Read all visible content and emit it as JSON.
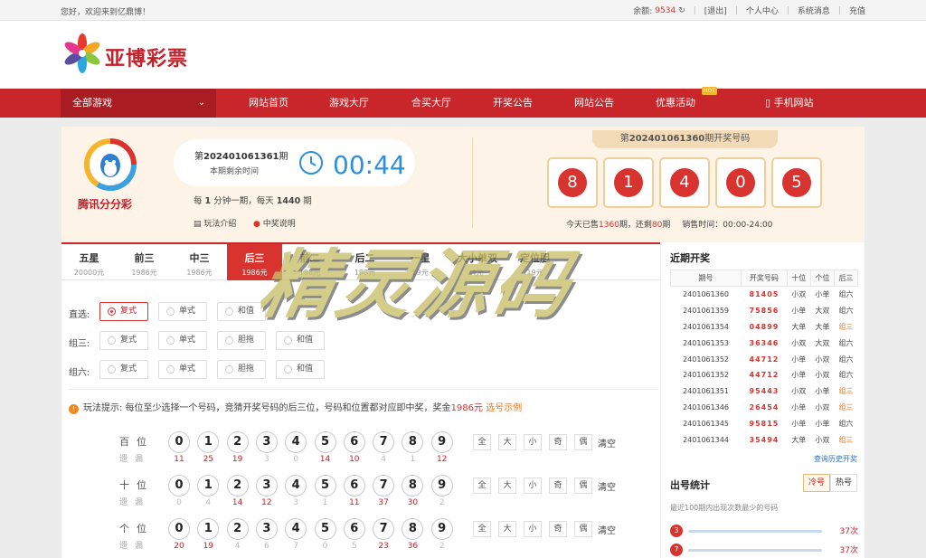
{
  "topbar": {
    "greeting": "您好，欢迎来到亿鼎博！",
    "balance_label": "余额:",
    "balance_value": "9534",
    "logout": "[退出]",
    "user_center": "个人中心",
    "messages": "系统消息",
    "recharge": "充值"
  },
  "brand": {
    "name": "亚博彩票"
  },
  "nav": {
    "all_games": "全部游戏",
    "items": [
      "网站首页",
      "游戏大厅",
      "合买大厅",
      "开奖公告",
      "网站公告",
      "优惠活动",
      "手机网站"
    ],
    "hot_badge": "HOT"
  },
  "game": {
    "name": "腾讯分分彩",
    "issue_prefix": "第",
    "issue_number": "202401061361",
    "issue_suffix": "期",
    "remaining_label": "本期剩余时间",
    "countdown": "00:44",
    "freq_a": "每",
    "freq_b": "1",
    "freq_c": "分钟一期，每天",
    "freq_d": "1440",
    "freq_e": "期",
    "rules_link": "玩法介绍",
    "prize_link": "中奖说明"
  },
  "last_draw": {
    "prefix": "第",
    "issue": "202401061360",
    "suffix": "期开奖号码",
    "balls": [
      "8",
      "1",
      "4",
      "0",
      "5"
    ],
    "sold_a": "今天已售",
    "sold_b": "1360",
    "sold_c": "期，还剩",
    "sold_d": "80",
    "sold_e": "期",
    "sale_time": "销售时间：00:00-24:00"
  },
  "tabs": [
    {
      "name": "五星",
      "prize": "20000元"
    },
    {
      "name": "前三",
      "prize": "1986元"
    },
    {
      "name": "中三",
      "prize": "1986元"
    },
    {
      "name": "后三",
      "prize": "1986元"
    },
    {
      "name": "前二",
      "prize": "198元"
    },
    {
      "name": "后二",
      "prize": "198元"
    },
    {
      "name": "一星",
      "prize": "19元"
    },
    {
      "name": "大小单双",
      "prize": "4元"
    },
    {
      "name": "定位胆",
      "prize": "19元"
    }
  ],
  "play_types": [
    {
      "label": "直选:",
      "options": [
        "复式",
        "单式",
        "和值"
      ]
    },
    {
      "label": "组三:",
      "options": [
        "复式",
        "单式",
        "胆拖",
        "和值"
      ]
    },
    {
      "label": "组六:",
      "options": [
        "复式",
        "单式",
        "胆拖",
        "和值"
      ]
    }
  ],
  "tip": {
    "label": "玩法提示:",
    "text": "每位至少选择一个号码，竞猜开奖号码的后三位，号码和位置都对应即中奖，奖金",
    "amount": "1986元",
    "link": "选号示例"
  },
  "number_rows": [
    {
      "position": "百位",
      "miss_label": "遗漏",
      "missing": [
        "11",
        "25",
        "19",
        "3",
        "0",
        "14",
        "10",
        "4",
        "1",
        "12"
      ]
    },
    {
      "position": "十位",
      "miss_label": "遗漏",
      "missing": [
        "0",
        "4",
        "14",
        "12",
        "3",
        "1",
        "11",
        "37",
        "30",
        "2"
      ]
    },
    {
      "position": "个位",
      "miss_label": "遗漏",
      "missing": [
        "20",
        "19",
        "4",
        "6",
        "7",
        "0",
        "5",
        "23",
        "36",
        "2"
      ]
    }
  ],
  "digits": [
    "0",
    "1",
    "2",
    "3",
    "4",
    "5",
    "6",
    "7",
    "8",
    "9"
  ],
  "quick_picks": [
    "全",
    "大",
    "小",
    "奇",
    "偶",
    "清空"
  ],
  "recent": {
    "title": "近期开奖",
    "headers": [
      "期号",
      "开奖号码",
      "十位",
      "个位",
      "后三"
    ],
    "rows": [
      [
        "2401061360",
        "81405",
        "小双",
        "小单",
        "组六"
      ],
      [
        "2401061359",
        "75856",
        "小单",
        "大双",
        "组六"
      ],
      [
        "2401061354",
        "04899",
        "大单",
        "大单",
        "组三"
      ],
      [
        "2401061353",
        "36346",
        "小双",
        "大双",
        "组六"
      ],
      [
        "2401061352",
        "44712",
        "小单",
        "小双",
        "组六"
      ],
      [
        "2401061352",
        "44712",
        "小单",
        "小双",
        "组六"
      ],
      [
        "2401061351",
        "95443",
        "小双",
        "小单",
        "组三"
      ],
      [
        "2401061346",
        "26454",
        "小单",
        "小双",
        "组三"
      ],
      [
        "2401061345",
        "95815",
        "小单",
        "小单",
        "组六"
      ],
      [
        "2401061344",
        "35494",
        "大单",
        "小双",
        "组三"
      ]
    ],
    "more": "查询历史开奖"
  },
  "stats": {
    "title": "出号统计",
    "tab_cold": "冷号",
    "tab_hot": "热号",
    "desc": "最近100期内出现次数最少的号码",
    "rows": [
      {
        "num": "3",
        "count": "37次"
      },
      {
        "num": "7",
        "count": "37次"
      }
    ]
  },
  "watermark": "精灵源码",
  "colors": {
    "brand_red": "#c9262b",
    "ball_red": "#d9332f",
    "countdown_blue": "#2f8fe0"
  }
}
